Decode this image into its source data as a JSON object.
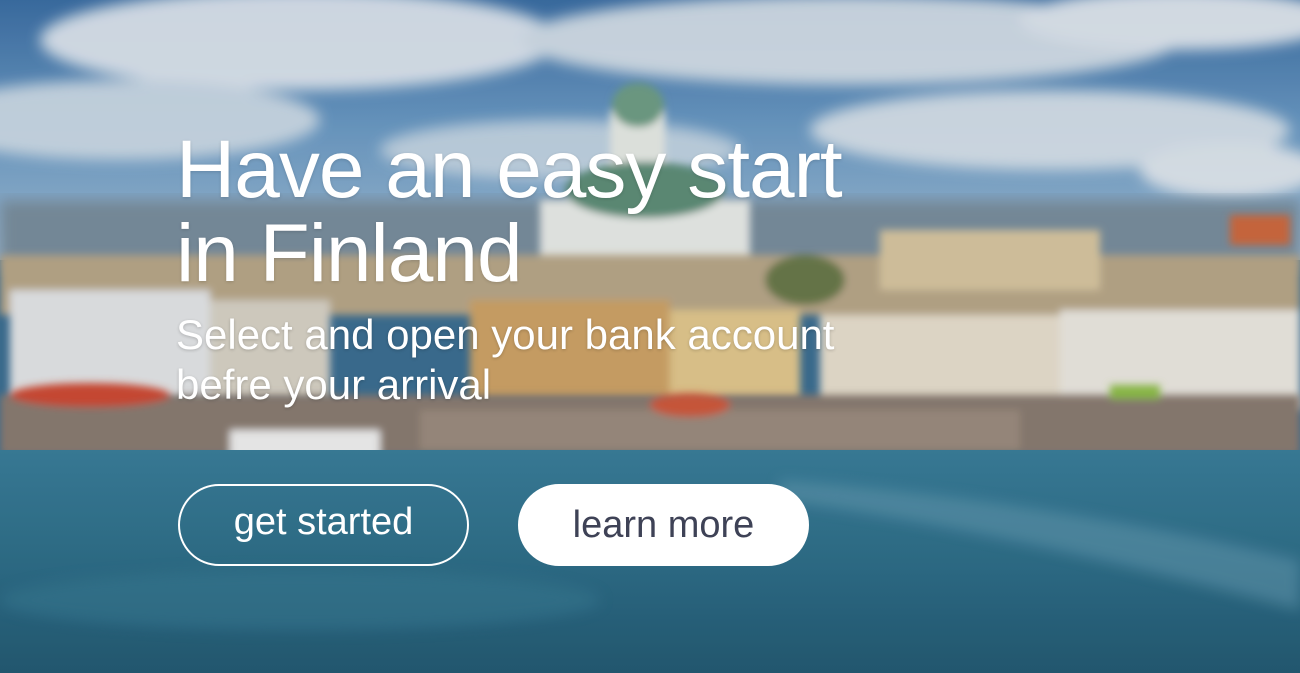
{
  "hero": {
    "headline_line1": "Have an easy start",
    "headline_line2": "in Finland",
    "subhead_line1": "Select and open your bank account",
    "subhead_line2": "befre your arrival",
    "primary_button": "get started",
    "secondary_button": "learn more"
  },
  "colors": {
    "text": "#ffffff",
    "solid_button_bg": "#ffffff",
    "solid_button_text": "#3e4256",
    "sky": "#4a86c0",
    "sea": "#2e6f8d"
  }
}
